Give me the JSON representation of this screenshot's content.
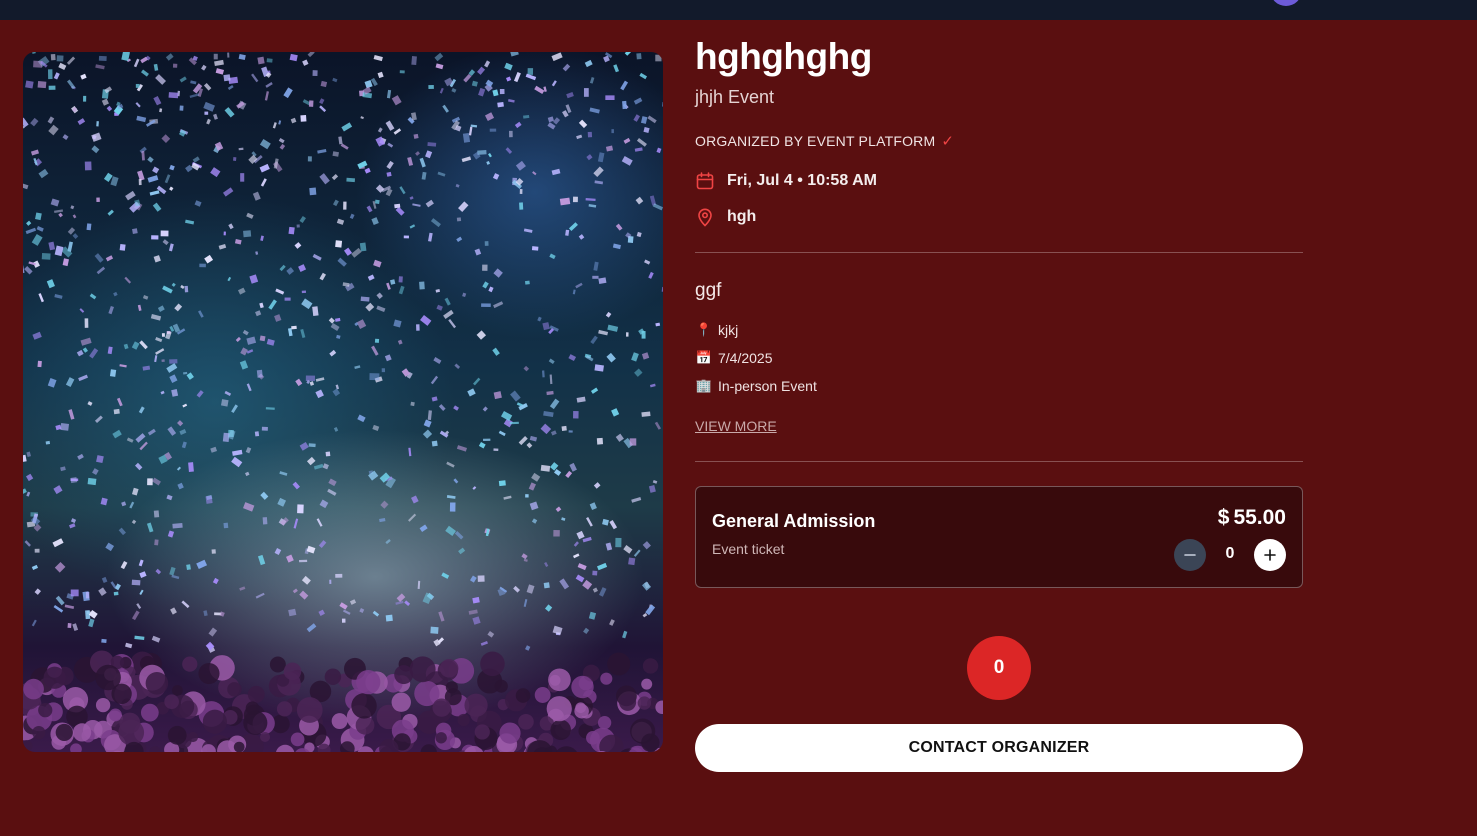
{
  "event": {
    "title": "hghghghg",
    "subtitle": "jhjh Event",
    "organizer": "ORGANIZED BY EVENT PLATFORM",
    "organizer_check": "✓",
    "datetime": "Fri, Jul 4 • 10:58 AM",
    "location": "hgh"
  },
  "description": {
    "title": "ggf",
    "details": [
      {
        "icon": "round-pushpin-icon",
        "emoji": "📍",
        "text": "kjkj"
      },
      {
        "icon": "calendar-icon",
        "emoji": "📅",
        "text": "7/4/2025"
      },
      {
        "icon": "building-icon",
        "emoji": "🏢",
        "text": "In-person Event"
      }
    ],
    "view_more": "VIEW MORE"
  },
  "ticket": {
    "name": "General Admission",
    "type": "Event ticket",
    "currency": "$",
    "price": "55.00",
    "quantity": "0"
  },
  "cart": {
    "count": "0"
  },
  "actions": {
    "contact": "CONTACT ORGANIZER"
  },
  "colors": {
    "background": "#5a0f10",
    "accent": "#dc2626",
    "icon": "#ef4444",
    "topbar": "#121a2b"
  }
}
